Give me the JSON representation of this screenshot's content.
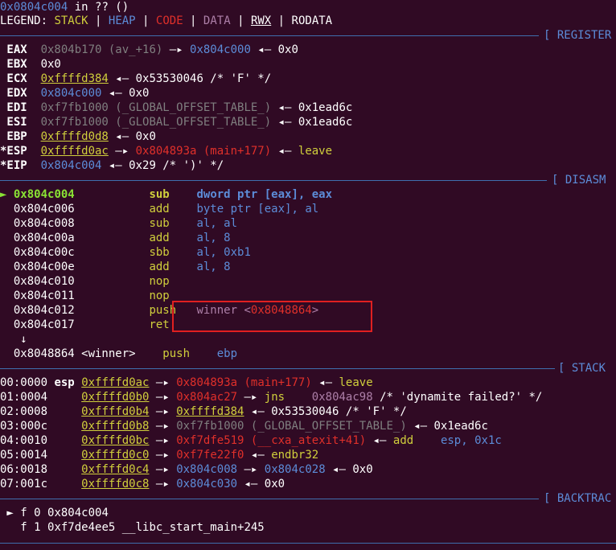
{
  "top": {
    "addr": "0x0804c004",
    "rest": " in ?? ()"
  },
  "legend": {
    "label": "LEGEND: ",
    "stack": "STACK",
    "heap": "HEAP",
    "code": "CODE",
    "data": "DATA",
    "rwx": "RWX",
    "rodata": "RODATA",
    "sep": " | "
  },
  "sections": {
    "register": "[ REGISTER",
    "disasm": "[ DISASM",
    "stack": "[ STACK",
    "backtrace": "[ BACKTRAC"
  },
  "registers": [
    {
      "name": " EAX",
      "v1": "0x804b170 (av_+16)",
      "a1": " —▸ ",
      "v2": "0x804c000",
      "a2": " ◂— ",
      "v3": "0x0"
    },
    {
      "name": " EBX",
      "v1": "0x0"
    },
    {
      "name": " ECX",
      "v1": "0xffffd384",
      "a1": " ◂— ",
      "v2": "0x53530046 /* 'F' */"
    },
    {
      "name": " EDX",
      "v1": "0x804c000",
      "a1": " ◂— ",
      "v2": "0x0"
    },
    {
      "name": " EDI",
      "v1": "0xf7fb1000 (_GLOBAL_OFFSET_TABLE_)",
      "a1": " ◂— ",
      "v2": "0x1ead6c"
    },
    {
      "name": " ESI",
      "v1": "0xf7fb1000 (_GLOBAL_OFFSET_TABLE_)",
      "a1": " ◂— ",
      "v2": "0x1ead6c"
    },
    {
      "name": " EBP",
      "v1": "0xffffd0d8",
      "a1": " ◂— ",
      "v2": "0x0"
    },
    {
      "name": "*ESP",
      "v1": "0xffffd0ac",
      "a1": " —▸ ",
      "v2": "0x804893a (main+177)",
      "a2": " ◂— ",
      "v3": "leave"
    },
    {
      "name": "*EIP",
      "v1": "0x804c004",
      "a1": " ◂— ",
      "v2": "0x29 /* ')' */"
    }
  ],
  "disasm": [
    {
      "marker": "►",
      "addr": "0x804c004",
      "mn": "sub",
      "op": "dword ptr [eax], eax"
    },
    {
      "addr": "0x804c006",
      "mn": "add",
      "op": "byte ptr [eax], al"
    },
    {
      "addr": "0x804c008",
      "mn": "sub",
      "op": "al, al"
    },
    {
      "addr": "0x804c00a",
      "mn": "add",
      "op": "al, 8"
    },
    {
      "addr": "0x804c00c",
      "mn": "sbb",
      "op": "al, 0xb1"
    },
    {
      "addr": "0x804c00e",
      "mn": "add",
      "op": "al, 8"
    },
    {
      "addr": "0x804c010",
      "mn": "nop",
      "op": ""
    },
    {
      "addr": "0x804c011",
      "mn": "nop",
      "op": ""
    },
    {
      "addr": "0x804c012",
      "mn": "push",
      "op1": "winner <",
      "op2": "0x8048864",
      "op3": ">"
    },
    {
      "addr": "0x804c017",
      "mn": "ret",
      "op": ""
    }
  ],
  "disasm_arrow": "↓",
  "disasm_last": {
    "addr": "0x8048864",
    "sym": " <winner>",
    "mn": "push",
    "op": "ebp"
  },
  "stack": [
    {
      "idx": "00:0000",
      "reg": "esp",
      "addr": "0xffffd0ac",
      "a1": " —▸ ",
      "v1": "0x804893a (main+177)",
      "a2": " ◂— ",
      "v2": "leave"
    },
    {
      "idx": "01:0004",
      "addr": "0xffffd0b0",
      "a1": " —▸ ",
      "v1": "0x804ac27",
      "a2": " —▸ ",
      "v2": "jns",
      "v3": "0x804ac98",
      "v4": " /* 'dynamite failed?' */"
    },
    {
      "idx": "02:0008",
      "addr": "0xffffd0b4",
      "a1": " —▸ ",
      "v1": "0xffffd384",
      "a2": " ◂— ",
      "v2": "0x53530046 /* 'F' */"
    },
    {
      "idx": "03:000c",
      "addr": "0xffffd0b8",
      "a1": " —▸ ",
      "v1": "0xf7fb1000 (_GLOBAL_OFFSET_TABLE_)",
      "a2": " ◂— ",
      "v2": "0x1ead6c"
    },
    {
      "idx": "04:0010",
      "addr": "0xffffd0bc",
      "a1": " —▸ ",
      "v1": "0xf7dfe519 (__cxa_atexit+41)",
      "a2": " ◂— ",
      "v2": "add",
      "v3": "esp, 0x1c"
    },
    {
      "idx": "05:0014",
      "addr": "0xffffd0c0",
      "a1": " —▸ ",
      "v1": "0xf7fe22f0",
      "a2": " ◂— ",
      "v2": "endbr32"
    },
    {
      "idx": "06:0018",
      "addr": "0xffffd0c4",
      "a1": " —▸ ",
      "v1": "0x804c008",
      "a2": " —▸ ",
      "v2": "0x804c028",
      "a3": " ◂— ",
      "v3": "0x0"
    },
    {
      "idx": "07:001c",
      "addr": "0xffffd0c8",
      "a1": " —▸ ",
      "v1": "0x804c030",
      "a2": " ◂— ",
      "v2": "0x0"
    }
  ],
  "backtrace": [
    {
      "marker": " ► ",
      "text": "f 0 0x804c004"
    },
    {
      "marker": "   ",
      "text": "f 1 0xf7de4ee5 __libc_start_main+245"
    }
  ]
}
